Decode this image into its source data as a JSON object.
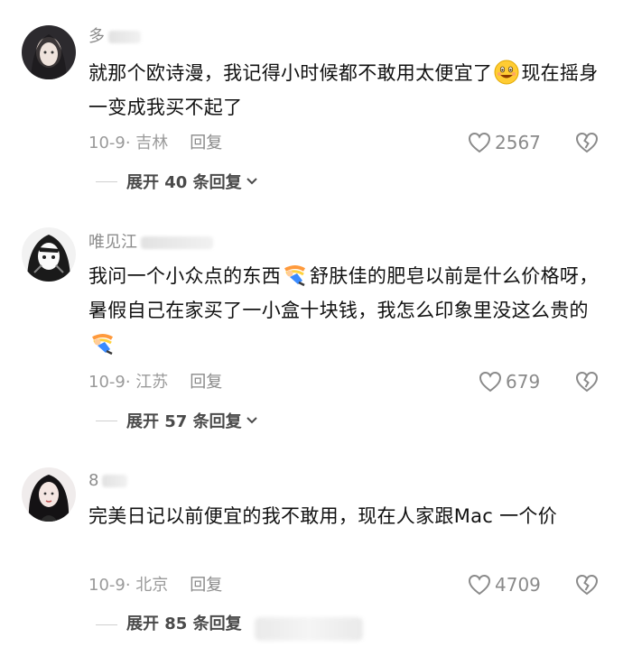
{
  "comments": [
    {
      "username": "多",
      "text_before_emoji": "就那个欧诗漫，我记得小时候都不敢用太便宜了",
      "text_after_emoji": "现在摇身一变成我买不起了",
      "emoji_icon": "grinning-face-icon",
      "date_location": "10-9· 吉林",
      "reply_label": "回复",
      "likes": "2567",
      "expand_label": "展开 40 条回复"
    },
    {
      "username": "唯见江",
      "text_part1": "我问一个小众点的东西",
      "text_part2": "舒肤佳的肥皂以前是什么价格呀，暑假自己在家买了一小盒十块钱，我怎么印象里没这么贵的",
      "emoji_icon": "falling-person-icon",
      "date_location": "10-9· 江苏",
      "reply_label": "回复",
      "likes": "679",
      "expand_label": "展开 57 条回复"
    },
    {
      "username": "8",
      "text": "完美日记以前便宜的我不敢用，现在人家跟Mac 一个价",
      "date_location": "10-9· 北京",
      "reply_label": "回复",
      "likes": "4709",
      "expand_label": "展开 85 条回复"
    }
  ],
  "icons": {
    "like": "heart-outline-icon",
    "dislike": "broken-heart-icon",
    "expand": "chevron-down-icon"
  },
  "colors": {
    "meta": "#9a9a9a",
    "text": "#111111",
    "expand": "#4a4a4a"
  }
}
